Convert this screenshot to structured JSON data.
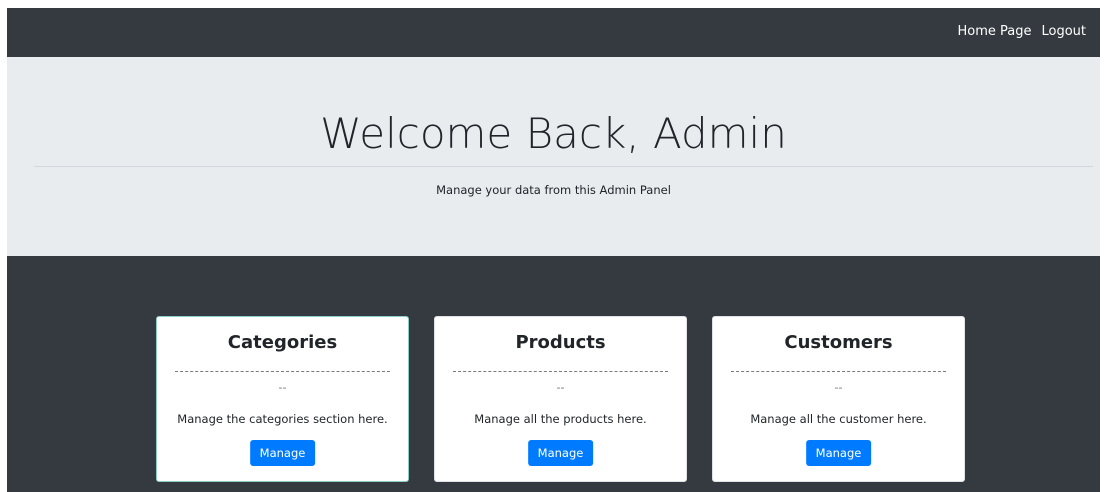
{
  "navbar": {
    "links": [
      {
        "label": "Home Page"
      },
      {
        "label": "Logout"
      }
    ]
  },
  "hero": {
    "title": "Welcome Back, Admin",
    "lead": "Manage your data from this Admin Panel"
  },
  "cards": [
    {
      "title": "Categories",
      "placeholder": "--",
      "text": "Manage the categories section here.",
      "button": "Manage"
    },
    {
      "title": "Products",
      "placeholder": "--",
      "text": "Manage all the products here.",
      "button": "Manage"
    },
    {
      "title": "Customers",
      "placeholder": "--",
      "text": "Manage all the customer here.",
      "button": "Manage"
    }
  ],
  "colors": {
    "navbar_bg": "#343a40",
    "hero_bg": "#e9ecef",
    "button_bg": "#007bff"
  }
}
